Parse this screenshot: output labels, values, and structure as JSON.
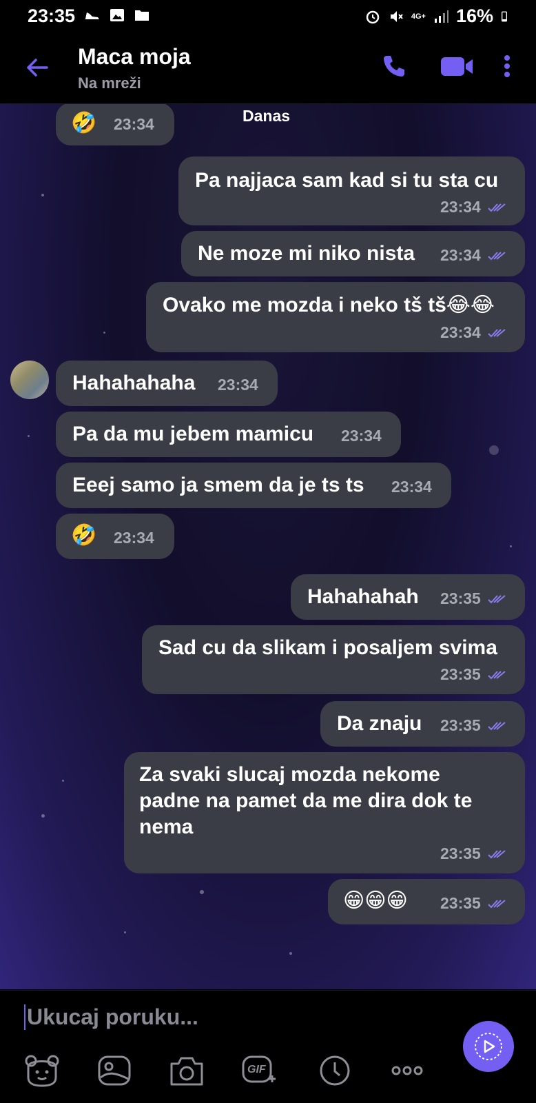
{
  "status_bar": {
    "time": "23:35",
    "network": "4G+",
    "battery": "16%"
  },
  "header": {
    "contact_name": "Maca moja",
    "contact_status": "Na mreži"
  },
  "date_separator": "Danas",
  "messages": [
    {
      "direction": "in",
      "text": "🤣",
      "time": "23:34"
    },
    {
      "direction": "out",
      "text": "Pa najjaca sam kad si tu sta cu",
      "time": "23:34"
    },
    {
      "direction": "out",
      "text": "Ne moze mi niko nista",
      "time": "23:34"
    },
    {
      "direction": "out",
      "text": "Ovako me mozda i neko tš tš😂😂",
      "time": "23:34"
    },
    {
      "direction": "in",
      "text": "Hahahahaha",
      "time": "23:34"
    },
    {
      "direction": "in",
      "text": "Pa da mu jebem mamicu",
      "time": "23:34"
    },
    {
      "direction": "in",
      "text": "Eeej samo ja smem da je ts ts",
      "time": "23:34"
    },
    {
      "direction": "in",
      "text": "🤣",
      "time": "23:34"
    },
    {
      "direction": "out",
      "text": "Hahahahah",
      "time": "23:35"
    },
    {
      "direction": "out",
      "text": "Sad cu da slikam i posaljem svima",
      "time": "23:35"
    },
    {
      "direction": "out",
      "text": "Da znaju",
      "time": "23:35"
    },
    {
      "direction": "out",
      "text_lines": [
        "Za svaki slucaj mozda nekome",
        "padne na pamet da me dira dok te",
        "nema"
      ],
      "time": "23:35"
    },
    {
      "direction": "out",
      "text": "😁😁😁",
      "time": "23:35"
    }
  ],
  "compose": {
    "placeholder": "Ukucaj poruku..."
  },
  "toolbar": {
    "icons": [
      "sticker-icon",
      "gallery-icon",
      "camera-icon",
      "gif-icon",
      "clock-icon",
      "more-icon"
    ],
    "gif_label": "GIF"
  },
  "colors": {
    "accent": "#7360f2",
    "bubble": "#3a3d45",
    "timestamp": "#a9abb3"
  }
}
